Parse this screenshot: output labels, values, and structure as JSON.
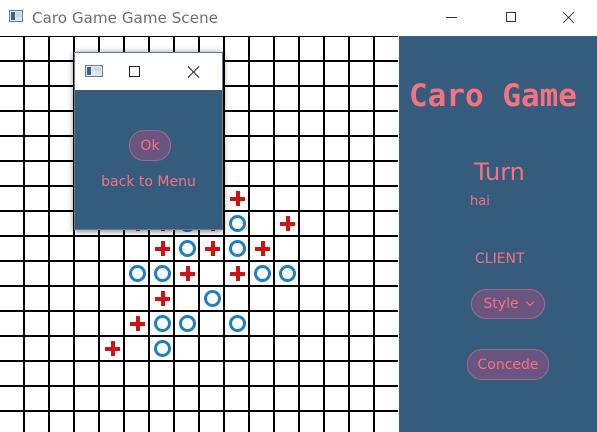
{
  "window": {
    "title": "Caro Game Game Scene"
  },
  "board": {
    "cols": 16,
    "rows": 16,
    "marks": [
      {
        "col": 9,
        "row": 6,
        "type": "X"
      },
      {
        "col": 5,
        "row": 7,
        "type": "X"
      },
      {
        "col": 6,
        "row": 7,
        "type": "X"
      },
      {
        "col": 7,
        "row": 7,
        "type": "O"
      },
      {
        "col": 8,
        "row": 7,
        "type": "X"
      },
      {
        "col": 9,
        "row": 7,
        "type": "O"
      },
      {
        "col": 11,
        "row": 7,
        "type": "X"
      },
      {
        "col": 6,
        "row": 8,
        "type": "X"
      },
      {
        "col": 7,
        "row": 8,
        "type": "O"
      },
      {
        "col": 8,
        "row": 8,
        "type": "X"
      },
      {
        "col": 9,
        "row": 8,
        "type": "O"
      },
      {
        "col": 10,
        "row": 8,
        "type": "X"
      },
      {
        "col": 5,
        "row": 9,
        "type": "O"
      },
      {
        "col": 6,
        "row": 9,
        "type": "O"
      },
      {
        "col": 7,
        "row": 9,
        "type": "X"
      },
      {
        "col": 9,
        "row": 9,
        "type": "X"
      },
      {
        "col": 10,
        "row": 9,
        "type": "O"
      },
      {
        "col": 11,
        "row": 9,
        "type": "O"
      },
      {
        "col": 6,
        "row": 10,
        "type": "X"
      },
      {
        "col": 8,
        "row": 10,
        "type": "O"
      },
      {
        "col": 5,
        "row": 11,
        "type": "X"
      },
      {
        "col": 6,
        "row": 11,
        "type": "O"
      },
      {
        "col": 7,
        "row": 11,
        "type": "O"
      },
      {
        "col": 9,
        "row": 11,
        "type": "O"
      },
      {
        "col": 4,
        "row": 12,
        "type": "X"
      },
      {
        "col": 6,
        "row": 12,
        "type": "O"
      }
    ]
  },
  "sidebar": {
    "title": "Caro Game",
    "turn_label": "Turn",
    "player_name": "hai",
    "role": "CLIENT",
    "style_button": "Style",
    "concede_button": "Concede"
  },
  "dialog": {
    "ok_button": "Ok",
    "back_to_menu": "back to Menu"
  },
  "colors": {
    "panel": "#355c7d",
    "accent_text": "#f67280",
    "button_fill": "#6a5480",
    "x_mark": "#cc1414",
    "o_mark": "#1f7fc4"
  }
}
